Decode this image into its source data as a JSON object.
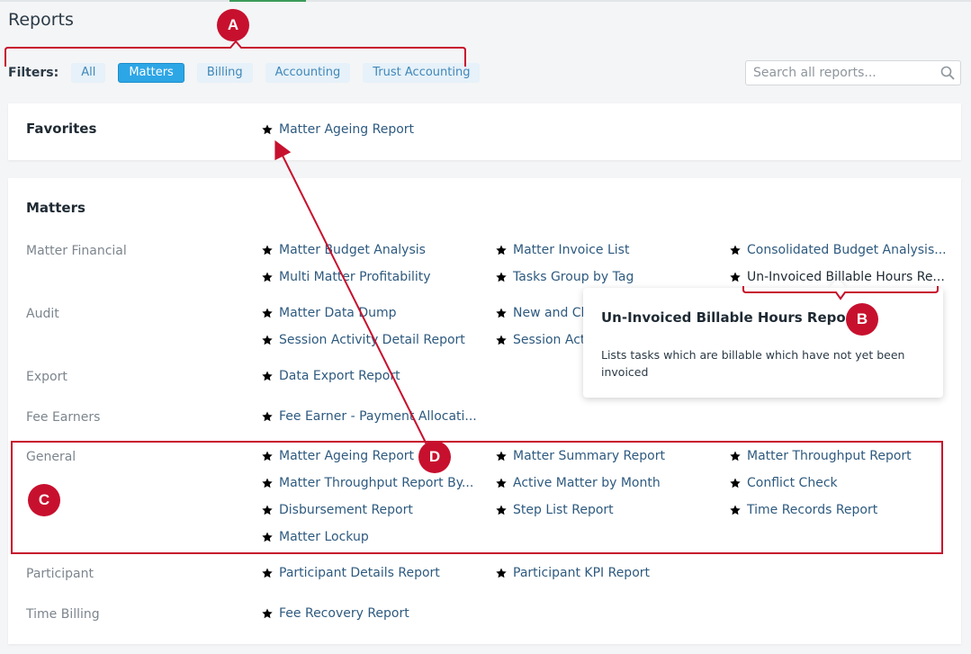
{
  "page": {
    "title": "Reports"
  },
  "filters": {
    "label": "Filters:",
    "chips": [
      "All",
      "Matters",
      "Billing",
      "Accounting",
      "Trust Accounting"
    ],
    "active": "Matters"
  },
  "search": {
    "placeholder": "Search all reports..."
  },
  "favorites": {
    "title": "Favorites",
    "items": [
      {
        "label": "Matter Ageing Report",
        "favorite": true
      }
    ]
  },
  "matters": {
    "title": "Matters",
    "groups": [
      {
        "label": "Matter Financial",
        "items": [
          {
            "label": "Matter Budget Analysis",
            "favorite": false
          },
          {
            "label": "Matter Invoice List",
            "favorite": false
          },
          {
            "label": "Consolidated Budget Analysis...",
            "favorite": false
          },
          {
            "label": "Multi Matter Profitability",
            "favorite": false
          },
          {
            "label": "Tasks Group by Tag",
            "favorite": false
          },
          {
            "label": "Un-Invoiced Billable Hours Re...",
            "favorite": false
          }
        ]
      },
      {
        "label": "Audit",
        "items": [
          {
            "label": "Matter Data Dump",
            "favorite": false
          },
          {
            "label": "New and Cl",
            "favorite": false
          },
          {
            "label": "Session Activity Detail Report",
            "favorite": false
          },
          {
            "label": "Session Act",
            "favorite": false
          }
        ]
      },
      {
        "label": "Export",
        "items": [
          {
            "label": "Data Export Report",
            "favorite": false
          }
        ]
      },
      {
        "label": "Fee Earners",
        "items": [
          {
            "label": "Fee Earner - Payment Allocati...",
            "favorite": false
          }
        ]
      },
      {
        "label": "General",
        "items": [
          {
            "label": "Matter Ageing Report",
            "favorite": true
          },
          {
            "label": "Matter Summary Report",
            "favorite": false
          },
          {
            "label": "Matter Throughput Report",
            "favorite": false
          },
          {
            "label": "Matter Throughput Report By...",
            "favorite": false
          },
          {
            "label": "Active Matter by Month",
            "favorite": false
          },
          {
            "label": "Conflict Check",
            "favorite": false
          },
          {
            "label": "Disbursement Report",
            "favorite": false
          },
          {
            "label": "Step List Report",
            "favorite": false
          },
          {
            "label": "Time Records Report",
            "favorite": false
          },
          {
            "label": "Matter Lockup",
            "favorite": false
          }
        ]
      },
      {
        "label": "Participant",
        "items": [
          {
            "label": "Participant Details Report",
            "favorite": false
          },
          {
            "label": "Participant KPI Report",
            "favorite": false
          }
        ]
      },
      {
        "label": "Time Billing",
        "items": [
          {
            "label": "Fee Recovery Report",
            "favorite": false
          }
        ]
      }
    ]
  },
  "tooltip": {
    "title": "Un-Invoiced Billable Hours Report",
    "description": "Lists tasks which are billable which have not yet been invoiced"
  },
  "annotations": {
    "badges": [
      "A",
      "B",
      "C",
      "D"
    ],
    "color": "#c7102e"
  },
  "colors": {
    "active_chip": "#2da6e6",
    "chip_bg": "#e6f1f9",
    "link": "#2e5a7f",
    "star_filled": "#3a85c6"
  }
}
